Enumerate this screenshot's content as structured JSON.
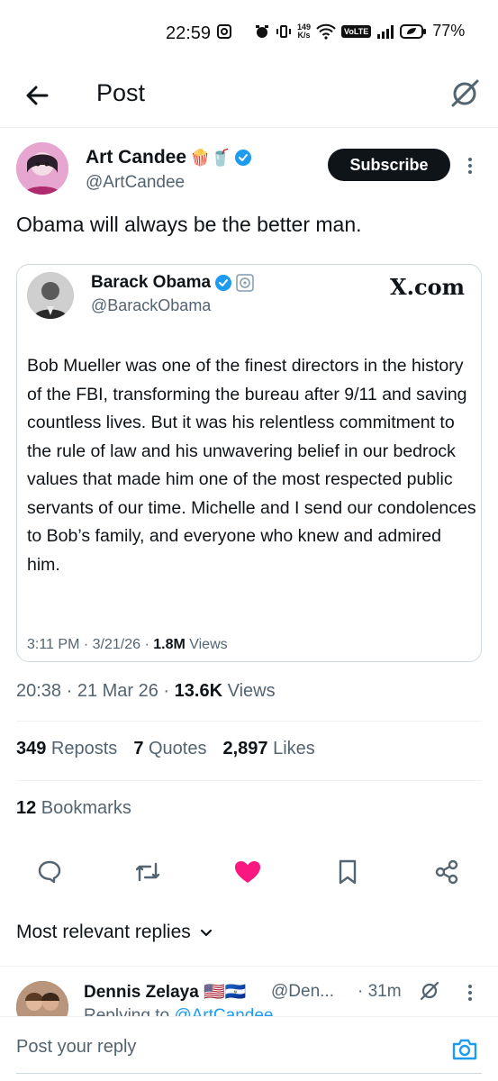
{
  "status_bar": {
    "time": "22:59",
    "speed_value": "149",
    "speed_unit": "K/s",
    "volte": "VoLTE",
    "battery": "77%"
  },
  "header": {
    "title": "Post"
  },
  "post": {
    "author_name": "Art Candee",
    "author_emojis": "🍿🥤",
    "author_handle": "@ArtCandee",
    "subscribe_label": "Subscribe",
    "text": "Obama will always be the better man.",
    "quote": {
      "name": "Barack Obama",
      "handle": "@BarackObama",
      "logo": "X.com",
      "text": "Bob Mueller was one of the finest directors in the history of the FBI, transforming the bureau after 9/11 and saving countless lives. But it was his relentless commitment to the rule of law and his unwavering belief in our bedrock values that made him one of the most respected public servants of our time. Michelle and I send our condolences to Bob’s family, and everyone who knew and admired him.",
      "time": "3:11 PM · 3/21/26 · ",
      "views_count": "1.8M",
      "views_label": " Views"
    },
    "time": "20:38 · 21 Mar 26 · ",
    "views_count": "13.6K",
    "views_label": " Views",
    "stats": {
      "reposts_count": "349",
      "reposts_label": " Reposts",
      "quotes_count": "7",
      "quotes_label": " Quotes",
      "likes_count": "2,897",
      "likes_label": " Likes",
      "bookmarks_count": "12",
      "bookmarks_label": " Bookmarks"
    }
  },
  "replies": {
    "sort_label": "Most relevant replies",
    "items": [
      {
        "name": "Dennis Zelaya",
        "flags": "🇺🇸🇸🇻",
        "handle": "@Den...",
        "time": "· 31m",
        "replying_prefix": "Replying to ",
        "replying_handle": "@ArtCandee"
      }
    ]
  },
  "reply_bar": {
    "placeholder": "Post your reply"
  },
  "colors": {
    "accent": "#1d9bf0",
    "like": "#f91880",
    "text": "#0f1419",
    "secondary": "#536471"
  }
}
